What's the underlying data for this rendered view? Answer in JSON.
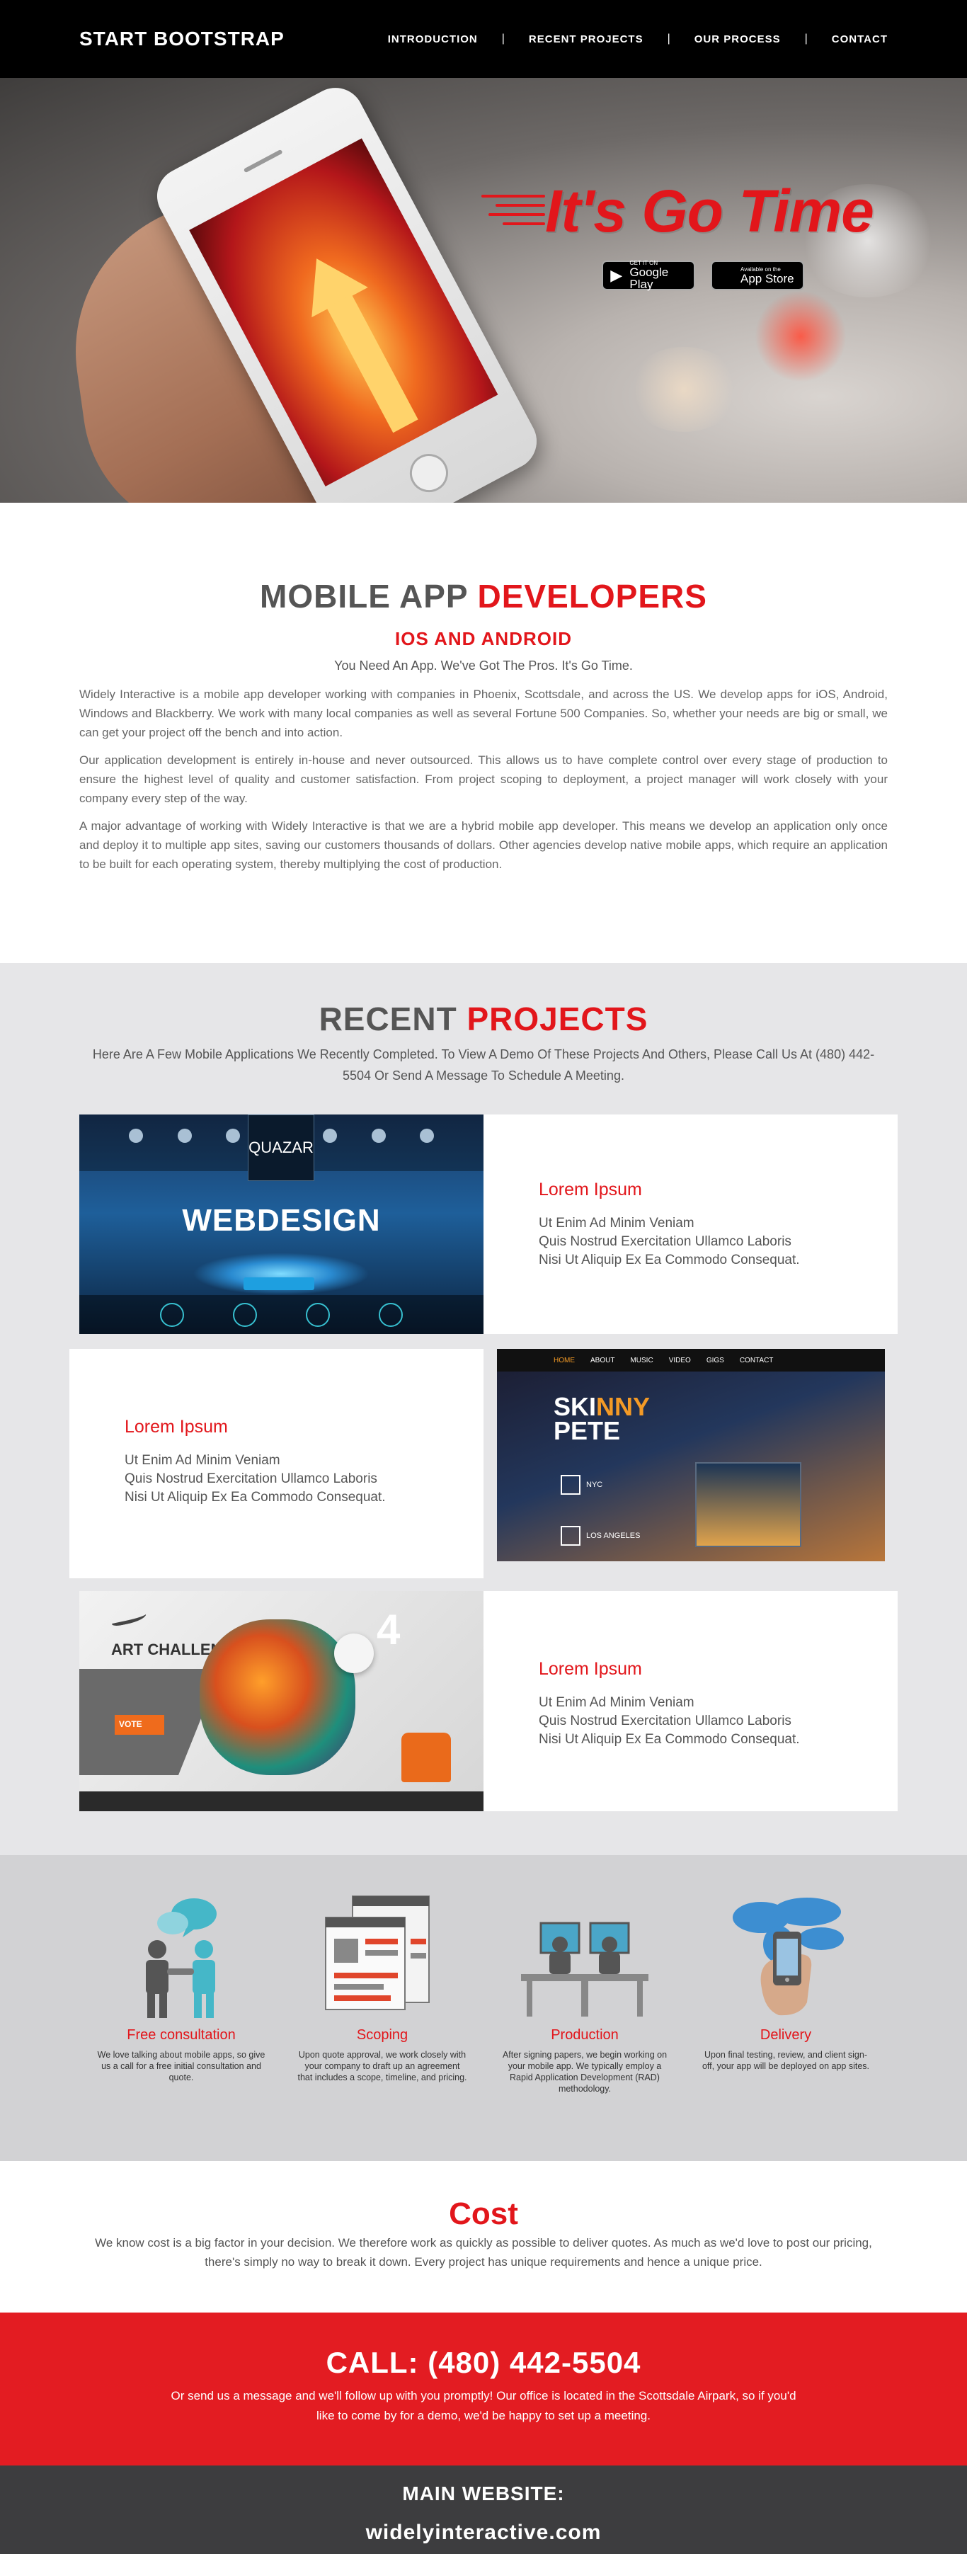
{
  "nav": {
    "brand": "START BOOTSTRAP",
    "items": [
      {
        "label": "INTRODUCTION"
      },
      {
        "label": "RECENT PROJECTS"
      },
      {
        "label": "OUR PROCESS"
      },
      {
        "label": "CONTACT"
      }
    ],
    "separator": "|"
  },
  "hero": {
    "tagline": "It's Go Time",
    "google_play": {
      "small": "GET IT ON",
      "big": "Google Play",
      "icon": "play-triangle-icon"
    },
    "app_store": {
      "small": "Available on the",
      "big": "App Store",
      "icon": "apple-icon"
    }
  },
  "about": {
    "title_a": "MOBILE APP",
    "title_b": "DEVELOPERS",
    "subtitle": "IOS AND ANDROID",
    "lead": "You Need An App. We've Got The Pros. It's Go Time.",
    "paragraphs": [
      "Widely Interactive is a mobile app developer working with companies in Phoenix, Scottsdale, and across the US. We develop apps for iOS, Android, Windows and Blackberry. We work with many local companies as well as several Fortune 500 Companies. So, whether your needs are big or small, we can get your project off the bench and into action.",
      "Our application development is entirely in-house and never outsourced. This allows us to have complete control over every stage of production to ensure the highest level of quality and customer satisfaction. From project scoping to deployment, a project manager will work closely with your company every step of the way.",
      "A major advantage of working with Widely Interactive is that we are a hybrid mobile app developer. This means we develop an application only once and deploy it to multiple app sites, saving our customers thousands of dollars. Other agencies develop native mobile apps, which require an application to be built for each operating system, thereby multiplying the cost of production."
    ]
  },
  "projects": {
    "title_a": "RECENT",
    "title_b": "PROJECTS",
    "intro": "Here Are A Few Mobile Applications We Recently Completed. To View A Demo Of These Projects And Others, Please Call Us At (480) 442-5504 Or Send A Message To Schedule A Meeting.",
    "items": [
      {
        "title": "Lorem Ipsum",
        "lines": [
          "Ut Enim Ad Minim Veniam",
          "Quis Nostrud Exercitation Ullamco Laboris",
          "Nisi Ut Aliquip Ex Ea Commodo Consequat."
        ],
        "thumb_text": "WEBDESIGN",
        "thumb_logo": "QUAZAR"
      },
      {
        "title": "Lorem Ipsum",
        "lines": [
          "Ut Enim Ad Minim Veniam",
          "Quis Nostrud Exercitation Ullamco Laboris",
          "Nisi Ut Aliquip Ex Ea Commodo Consequat."
        ],
        "thumb_title_a": "SKI",
        "thumb_title_b": "NNY",
        "thumb_title_c": "PETE",
        "thumb_nav": [
          "HOME",
          "ABOUT",
          "MUSIC",
          "VIDEO",
          "GIGS",
          "CONTACT"
        ],
        "thumb_events": [
          "NYC",
          "LOS ANGELES"
        ]
      },
      {
        "title": "Lorem Ipsum",
        "lines": [
          "Ut Enim Ad Minim Veniam",
          "Quis Nostrud Exercitation Ullamco Laboris",
          "Nisi Ut Aliquip Ex Ea Commodo Consequat."
        ],
        "thumb_text": "ART CHALLENGE 2.0",
        "thumb_badge": "VOTE",
        "thumb_big": "4"
      }
    ]
  },
  "process": {
    "steps": [
      {
        "title": "Free consultation",
        "text": "We love talking about mobile apps, so give us a call for a free initial consultation and quote."
      },
      {
        "title": "Scoping",
        "text": "Upon quote approval, we work closely with your company to draft up an agreement that includes a scope, timeline, and pricing."
      },
      {
        "title": "Production",
        "text": "After signing papers, we begin working on your mobile app. We typically employ a Rapid Application Development (RAD) methodology."
      },
      {
        "title": "Delivery",
        "text": "Upon final testing, review, and client sign-off, your app will be deployed on app sites."
      }
    ]
  },
  "cost": {
    "title": "Cost",
    "text": "We know cost is a big factor in your decision. We therefore work as quickly as possible to deliver quotes. As much as we'd love to post our pricing, there's simply no way to break it down. Every project has unique requirements and hence a unique price."
  },
  "call": {
    "title": "CALL: (480) 442-5504",
    "text": "Or send us a message and we'll follow up with you promptly! Our office is located in the Scottsdale Airpark, so if you'd like to come by for a demo, we'd be happy to set up a meeting."
  },
  "footer": {
    "label": "MAIN WEBSITE:",
    "site": "widelyinteractive.com"
  },
  "colors": {
    "accent": "#e2161b",
    "nav_bg": "#000000",
    "section_gray": "#e6e6e8",
    "footer_bg": "#3d3d3f"
  }
}
